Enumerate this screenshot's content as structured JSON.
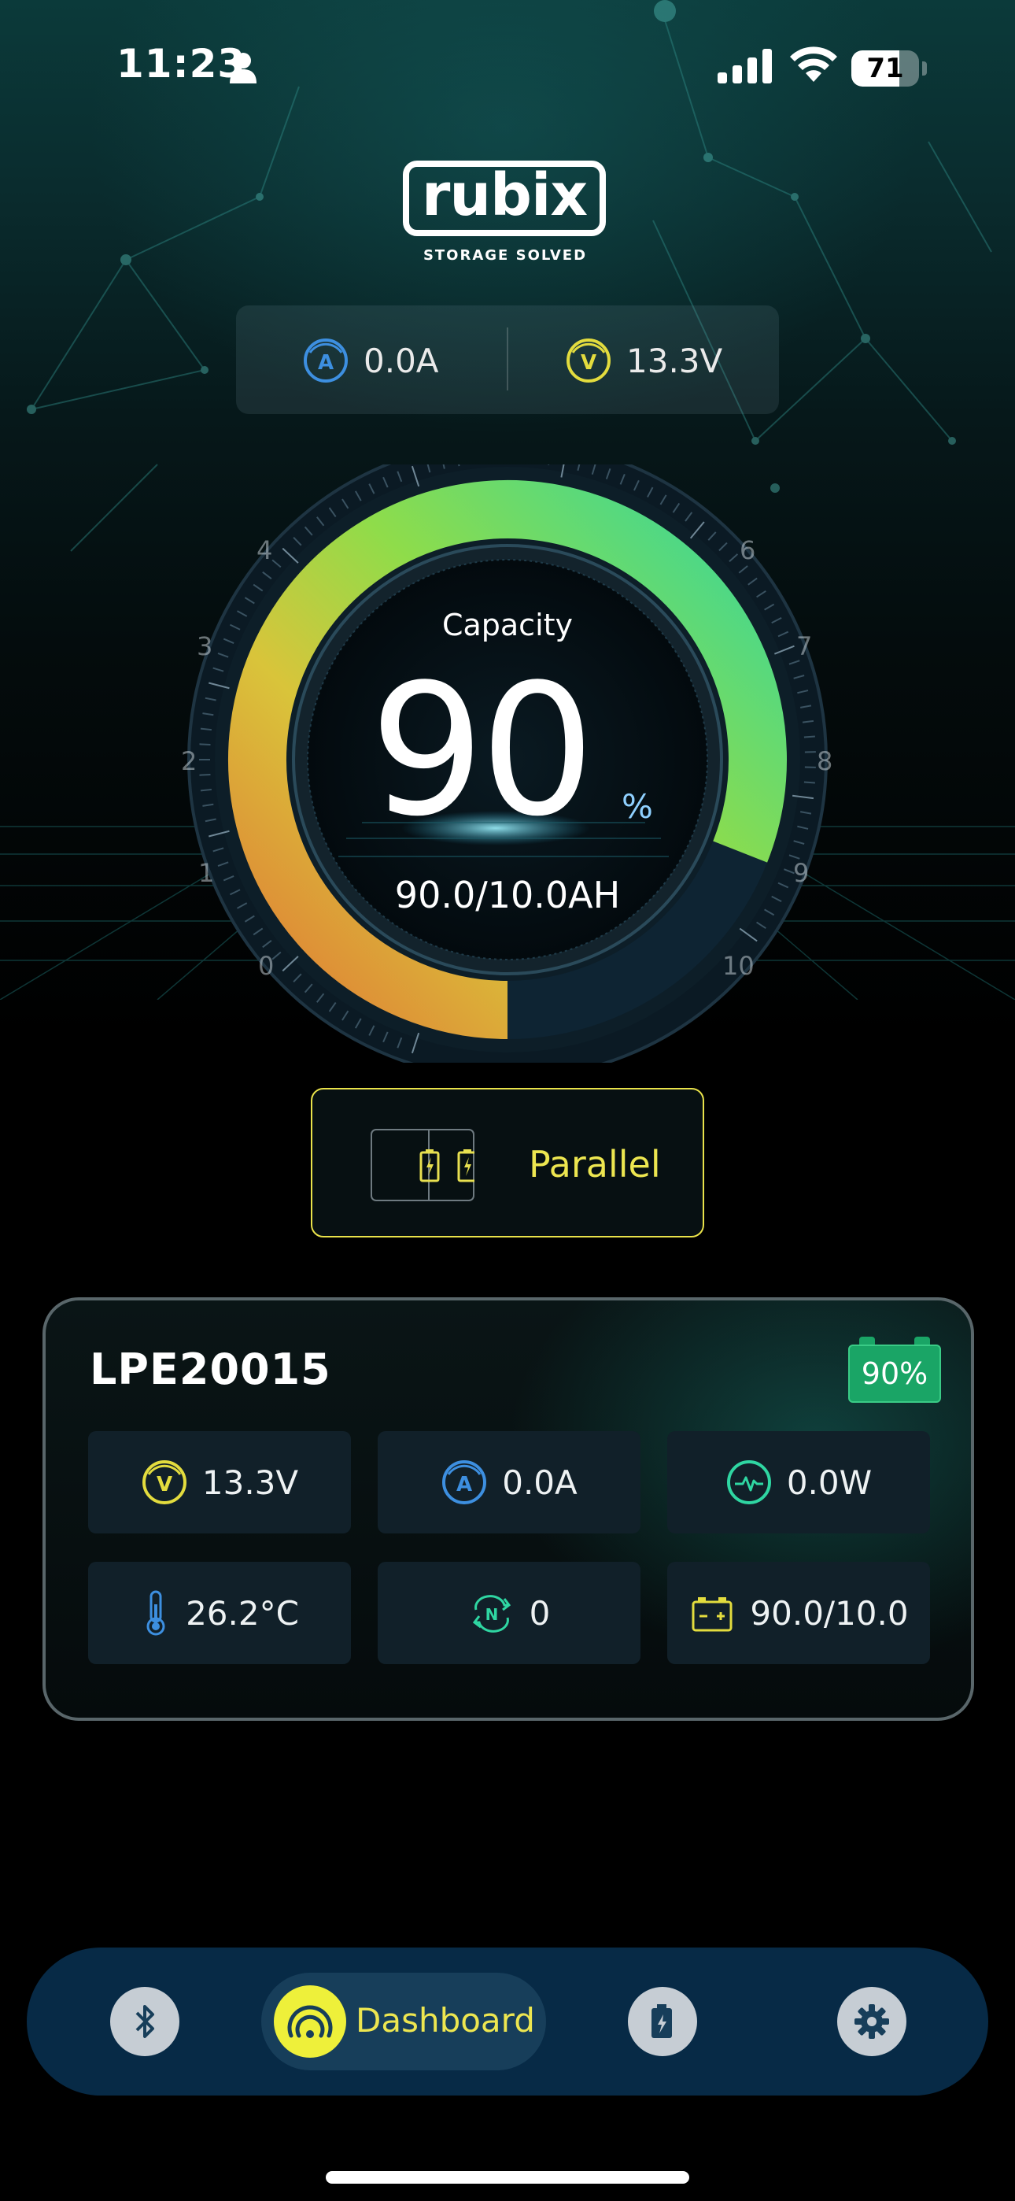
{
  "status_bar": {
    "time": "11:23",
    "battery_level": "71"
  },
  "brand": {
    "logo_text": "rubix",
    "tagline": "STORAGE SOLVED"
  },
  "readout": {
    "current": "0.0A",
    "voltage": "13.3V"
  },
  "gauge": {
    "label": "Capacity",
    "value": "90",
    "value_percent": 90,
    "unit": "%",
    "amp_hours": "90.0/10.0AH",
    "scale_ticks": [
      "0",
      "1",
      "2",
      "3",
      "4",
      "6",
      "7",
      "8",
      "9",
      "10"
    ]
  },
  "mode": {
    "label": "Parallel"
  },
  "device": {
    "name": "LPE20015",
    "battery_percent": "90%",
    "stats": {
      "voltage": "13.3V",
      "current": "0.0A",
      "power": "0.0W",
      "temperature": "26.2°C",
      "cycles": "0",
      "capacity": "90.0/10.0"
    }
  },
  "nav": {
    "active_label": "Dashboard",
    "items": [
      "bluetooth",
      "dashboard",
      "battery",
      "settings"
    ]
  },
  "colors": {
    "accent_yellow": "#ede650",
    "accent_blue": "#3d8fe0",
    "accent_green": "#2fd6a2",
    "badge_green": "#1aa566",
    "nav_bg": "#072a46"
  }
}
